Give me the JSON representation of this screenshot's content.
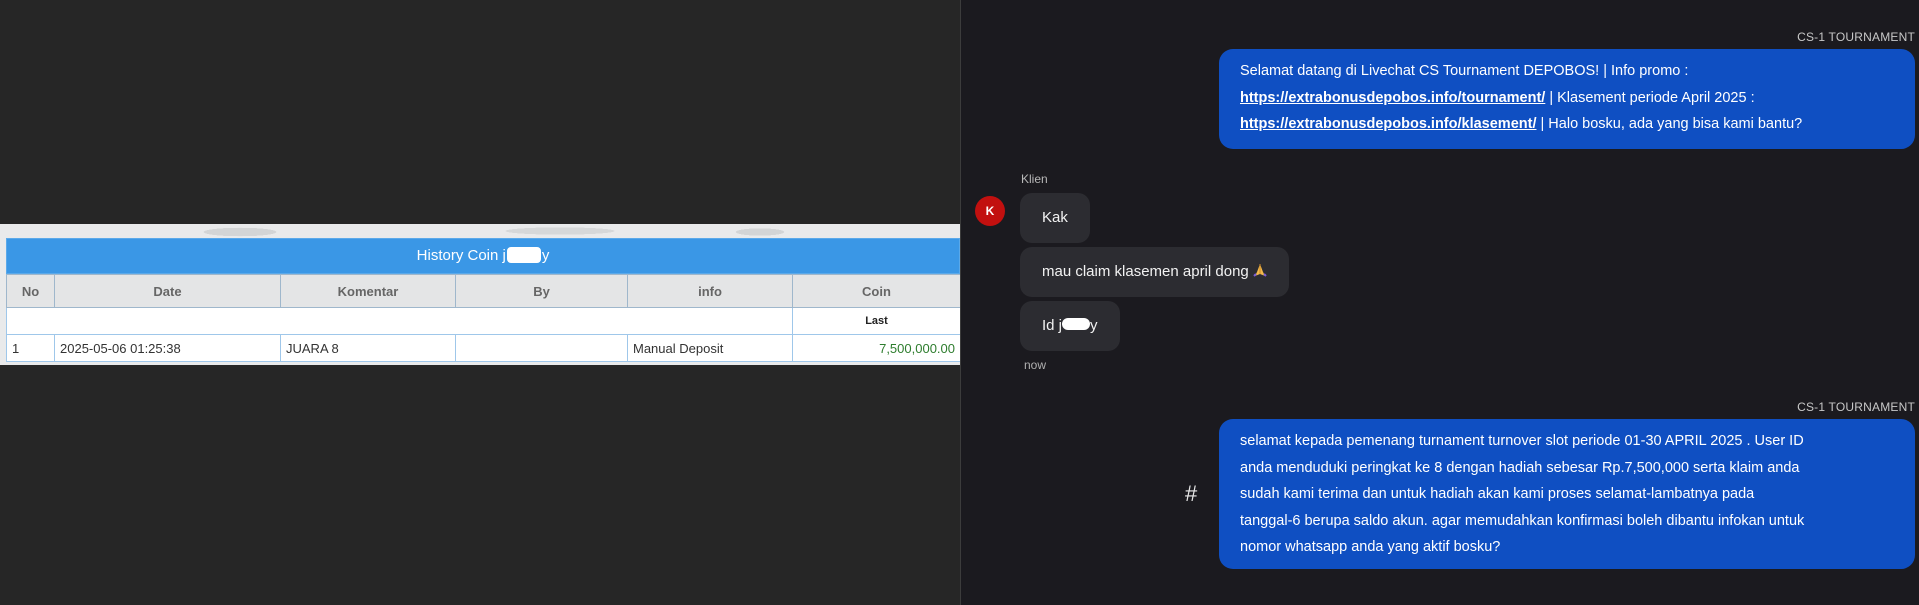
{
  "history": {
    "title_prefix": "History Coin j",
    "title_suffix": "y",
    "columns": [
      "No",
      "Date",
      "Komentar",
      "By",
      "info",
      "Coin"
    ],
    "last_label": "Last",
    "rows": [
      {
        "no": "1",
        "date": "2025-05-06 01:25:38",
        "komentar": "JUARA 8",
        "by": "",
        "info": "Manual Deposit",
        "coin": "7,500,000.00"
      }
    ]
  },
  "chat": {
    "agent_name": "CS-1 TOURNAMENT",
    "welcome": {
      "text1": "Selamat datang di Livechat CS Tournament DEPOBOS! | Info promo :",
      "link1": "https://extrabonusdepobos.info/tournament/",
      "text2": " | Klasement periode April 2025 :",
      "link2": "https://extrabonusdepobos.info/klasement/",
      "text3": " | Halo bosku, ada yang bisa kami bantu?"
    },
    "client_label": "Klien",
    "client_initial": "K",
    "client_messages": {
      "msg1": "Kak",
      "msg2": "mau claim klasemen april dong",
      "msg3_prefix": "Id j",
      "msg3_suffix": "y"
    },
    "time": "now",
    "agent_name_2": "CS-1 TOURNAMENT",
    "reply": {
      "line1": "selamat kepada pemenang turnament turnover slot periode 01-30 APRIL 2025 . User ID",
      "line2": "anda menduduki peringkat ke 8 dengan hadiah sebesar Rp.7,500,000 serta klaim anda",
      "line3": "sudah kami terima dan untuk hadiah akan kami proses selamat-lambatnya pada",
      "line4": "tanggal-6 berupa saldo akun. agar memudahkan konfirmasi boleh dibantu infokan untuk",
      "line5": "nomor whatsapp anda yang aktif bosku?"
    },
    "hash_symbol": "#"
  },
  "colors": {
    "agent_bubble": "#0f4fc2",
    "client_bubble": "#2c2c31",
    "avatar": "#c2100f",
    "table_header": "#3a97e6",
    "coin_text": "#2e7d2e"
  },
  "icons": [
    "hash-icon",
    "pray-emoji-icon",
    "avatar-icon"
  ]
}
